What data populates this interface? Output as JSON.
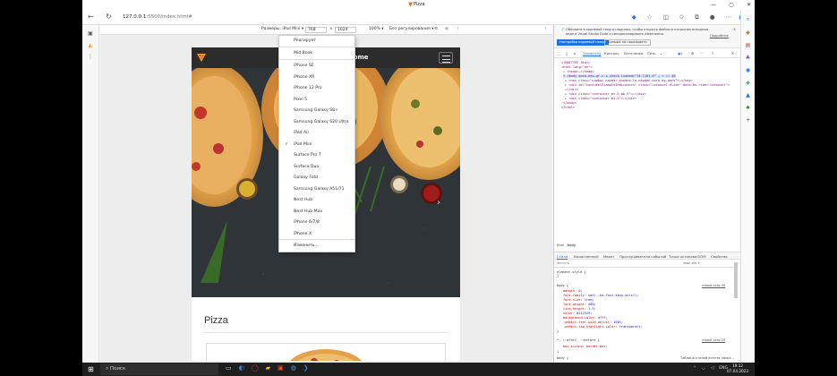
{
  "browser": {
    "tab_title": "Pizza",
    "url_host": "127.0.0.1",
    "url_path": ":5500/index.html#",
    "window_controls": [
      "—",
      "▢",
      "✕"
    ]
  },
  "device_toolbar": {
    "dimensions_label": "Размеры: iPad Mini ▾",
    "width": "768",
    "height": "1024",
    "zoom": "100% ▾",
    "throttle": "Без регулирования ▾"
  },
  "device_menu": {
    "items": [
      "Реагирует",
      "Mid Book",
      "iPhone SE",
      "iPhone XR",
      "iPhone 12 Pro",
      "Pixel 5",
      "Samsung Galaxy S8+",
      "Samsung Galaxy S20 Ultra",
      "iPad Air",
      "iPad Mini",
      "Surface Pro 7",
      "Surface Duo",
      "Galaxy Fold",
      "Samsung Galaxy A51/71",
      "Nest Hub",
      "Nest Hub Max",
      "iPhone 6/7/8",
      "iPhone X",
      "Изменить..."
    ],
    "selected": "iPad Mini"
  },
  "site": {
    "brand": "Pizza Home",
    "section_title": "Pizza"
  },
  "devtools": {
    "notice_line1": "Обновите в корневой тему отладчика, чтобы открыть файлы в открытом исходном",
    "notice_line2": "виде в Visual Studio Code и синхронизировать изменения.",
    "notice_link": "Подробнее",
    "notice_btn_primary": "Настройка корневой папки",
    "notice_btn_secondary": "Больше не показывать",
    "tabs": [
      "Элементы",
      "Консоль",
      "Источники",
      "Сеть"
    ],
    "dom_lines": [
      "<!DOCTYPE html>",
      "<html lang=\"en\">",
      "▸ <head>…</head>",
      "▾ <body data-new-gr-c-s-check-loaded=\"14.1101.0\" … > == $0",
      "  ▸ <nav class=\"navbar navbar-expand-lg navbar-dark bg-dark\">…</nav>",
      "  ▸ <div id=\"carouselExampleIndicators\" class=\"carousel slide\" data-bs-ride=\"carousel\">",
      "    …</div>",
      "  ▸ <div class=\"container mt-5 mb-5\">…</div>",
      "  ▸ <div class=\"container mt-5\">…</div>",
      "  </body>",
      "</html>"
    ],
    "breadcrumb": [
      "html",
      "body"
    ],
    "bottom_tabs": [
      "Стили",
      "Вычисленный",
      "Макет",
      "Прослушиватели событий",
      "Точки останова DOM",
      "Свойства"
    ],
    "filter_placeholder": "Фильтр",
    "filter_actions": ":hov  .cls  +",
    "element_style": "element.style {",
    "css_rule_selector": "body {",
    "css_rule_source": "reboot.scss:49",
    "css_props": [
      {
        "p": "margin",
        "v": "0;"
      },
      {
        "p": "font-family",
        "v": "var(--bs-font-sans-serif);"
      },
      {
        "p": "font-size",
        "v": "1rem;"
      },
      {
        "p": "font-weight",
        "v": "400;"
      },
      {
        "p": "line-height",
        "v": "1.5;"
      },
      {
        "p": "color",
        "v": "#212529;"
      },
      {
        "p": "background-color",
        "v": "#fff;"
      },
      {
        "p": "-webkit-text-size-adjust",
        "v": "100%;"
      },
      {
        "p": "-webkit-tap-highlight-color",
        "v": "transparent;"
      }
    ],
    "rule2_selector": "*, ::after, ::before {",
    "rule2_source": "reboot.scss:19",
    "rule2_prop": "box-sizing: border-box;",
    "rule3_selector": "body {",
    "rule3_source": "Таблица стилей агента польз..."
  },
  "taskbar": {
    "search": "Поиск",
    "lang": "ENG",
    "time": "19:12",
    "date": "07.04.2023"
  },
  "colors": {
    "accent": "#1a73e8",
    "site_nav": "#2c2c2c",
    "taskbar": "#1e1e1e"
  }
}
